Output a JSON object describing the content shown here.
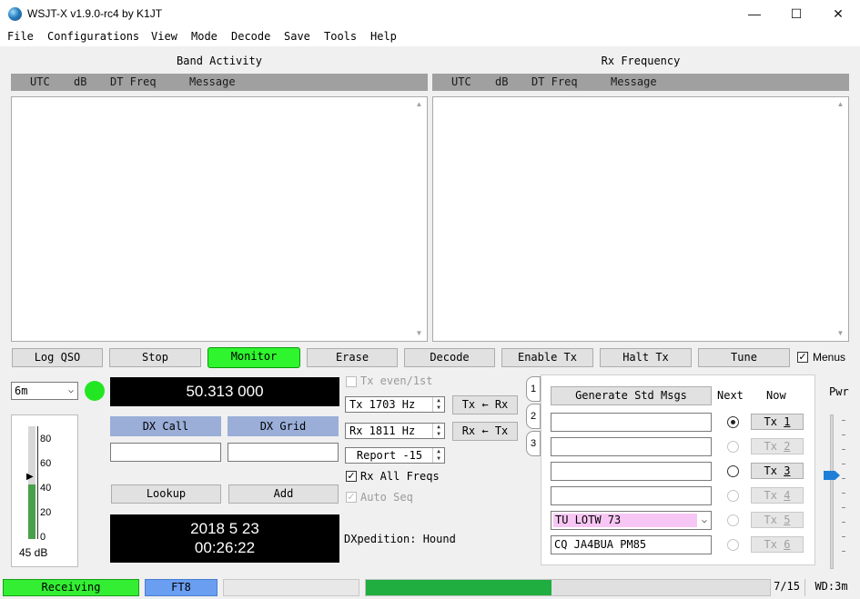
{
  "window": {
    "title": "WSJT-X   v1.9.0-rc4   by K1JT",
    "minimize_glyph": "—",
    "maximize_glyph": "☐",
    "close_glyph": "✕"
  },
  "menu": {
    "items": [
      "File",
      "Configurations",
      "View",
      "Mode",
      "Decode",
      "Save",
      "Tools",
      "Help"
    ]
  },
  "band_activity": {
    "title": "Band Activity",
    "columns": [
      "UTC",
      "dB",
      "DT Freq",
      "Message"
    ]
  },
  "rx_frequency": {
    "title": "Rx Frequency",
    "columns": [
      "UTC",
      "dB",
      "DT Freq",
      "Message"
    ]
  },
  "controls": {
    "log_qso": "Log QSO",
    "stop": "Stop",
    "monitor": "Monitor",
    "erase": "Erase",
    "decode": "Decode",
    "enable_tx": "Enable Tx",
    "halt_tx": "Halt Tx",
    "tune": "Tune",
    "menus_label": "Menus",
    "menus_checked": true
  },
  "band": {
    "selected": "6m",
    "indicator_color": "#22e622"
  },
  "frequency_display": "50.313 000",
  "dx": {
    "call_label": "DX Call",
    "grid_label": "DX Grid",
    "call_value": "",
    "grid_value": "",
    "lookup": "Lookup",
    "add": "Add"
  },
  "clock": {
    "date": "2018 5 23",
    "time": "00:26:22"
  },
  "signal_meter": {
    "ticks": [
      "80",
      "60",
      "40",
      "20",
      "0"
    ],
    "level_db": "45 dB",
    "level_value": 45
  },
  "tx_settings": {
    "tx_even_label": "Tx even/1st",
    "tx_freq": "Tx  1703  Hz",
    "rx_freq": "Rx  1811  Hz",
    "tx_to_rx": "Tx ← Rx",
    "rx_to_tx": "Rx ← Tx",
    "report": "Report -15",
    "rx_all_freqs_label": "Rx All Freqs",
    "auto_seq_label": "Auto Seq",
    "dxpedition": "DXpedition: Hound"
  },
  "messages": {
    "tabs": [
      "1",
      "2",
      "3"
    ],
    "generate": "Generate Std Msgs",
    "next_label": "Next",
    "now_label": "Now",
    "rows": [
      {
        "text": "",
        "tx": "Tx 1",
        "tx_num": "1",
        "enabled": true,
        "selected": true
      },
      {
        "text": "",
        "tx": "Tx 2",
        "tx_num": "2",
        "enabled": false,
        "selected": false
      },
      {
        "text": "",
        "tx": "Tx 3",
        "tx_num": "3",
        "enabled": true,
        "selected": false
      },
      {
        "text": "",
        "tx": "Tx 4",
        "tx_num": "4",
        "enabled": false,
        "selected": false
      },
      {
        "text": "TU LOTW 73",
        "tx": "Tx 5",
        "tx_num": "5",
        "enabled": false,
        "selected": false
      },
      {
        "text": "CQ JA4BUA PM85",
        "tx": "Tx 6",
        "tx_num": "6",
        "enabled": false,
        "selected": false
      }
    ]
  },
  "power": {
    "label": "Pwr"
  },
  "status_bar": {
    "state": "Receiving",
    "mode": "FT8",
    "progress_value": 0.46,
    "period": "7/15",
    "wd": "WD:3m",
    "state_color": "#33ee33",
    "mode_color": "#6a9ef0",
    "progress_color": "#1fae3f"
  }
}
